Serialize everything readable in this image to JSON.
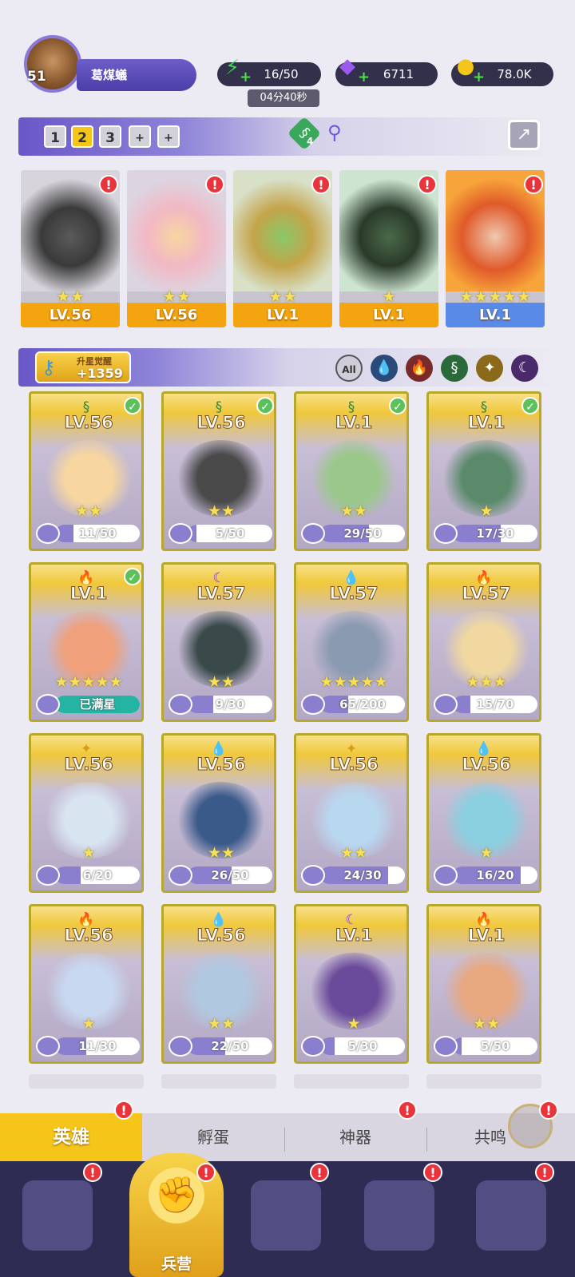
{
  "player": {
    "level": "51",
    "name": "葛煤蟻"
  },
  "resources": {
    "energy": "16/50",
    "timer": "04分40秒",
    "gems": "6711",
    "gold": "78.0K"
  },
  "team": {
    "slots": [
      "1",
      "2",
      "3",
      "+",
      "+"
    ],
    "active_slot": "2",
    "element_count": "4"
  },
  "heroes_team": [
    {
      "stars": "★★",
      "level": "LV.56",
      "element": "wind"
    },
    {
      "stars": "★★",
      "level": "LV.56",
      "element": "wind"
    },
    {
      "stars": "★★",
      "level": "LV.1",
      "element": "wind"
    },
    {
      "stars": "★",
      "level": "LV.1",
      "element": "wind"
    },
    {
      "stars": "★★★★★",
      "level": "LV.1",
      "element": "fire"
    }
  ],
  "awaken": {
    "label": "升星觉醒",
    "value": "+1359"
  },
  "filters": [
    "All",
    "water",
    "fire",
    "wind",
    "light",
    "dark"
  ],
  "cards": [
    {
      "level": "LV.56",
      "stars": "★★",
      "progress": "11/50",
      "fraction": 0.22,
      "element": "wind",
      "check": true
    },
    {
      "level": "LV.56",
      "stars": "★★",
      "progress": "5/50",
      "fraction": 0.1,
      "element": "wind",
      "check": true
    },
    {
      "level": "LV.1",
      "stars": "★★",
      "progress": "29/50",
      "fraction": 0.58,
      "element": "wind",
      "check": true
    },
    {
      "level": "LV.1",
      "stars": "★",
      "progress": "17/30",
      "fraction": 0.57,
      "element": "wind",
      "check": true
    },
    {
      "level": "LV.1",
      "stars": "★★★★★",
      "progress": "已满星",
      "fraction": 1.0,
      "element": "fire",
      "check": true
    },
    {
      "level": "LV.57",
      "stars": "★★",
      "progress": "9/30",
      "fraction": 0.3,
      "element": "dark",
      "check": false
    },
    {
      "level": "LV.57",
      "stars": "★★★★★",
      "progress": "65/200",
      "fraction": 0.33,
      "element": "water",
      "check": false
    },
    {
      "level": "LV.57",
      "stars": "★★★",
      "progress": "15/70",
      "fraction": 0.21,
      "element": "fire",
      "check": false
    },
    {
      "level": "LV.56",
      "stars": "★",
      "progress": "6/20",
      "fraction": 0.3,
      "element": "light",
      "check": false
    },
    {
      "level": "LV.56",
      "stars": "★★",
      "progress": "26/50",
      "fraction": 0.52,
      "element": "water",
      "check": false
    },
    {
      "level": "LV.56",
      "stars": "★★",
      "progress": "24/30",
      "fraction": 0.8,
      "element": "light",
      "check": false
    },
    {
      "level": "LV.56",
      "stars": "★",
      "progress": "16/20",
      "fraction": 0.8,
      "element": "water",
      "check": false
    },
    {
      "level": "LV.56",
      "stars": "★",
      "progress": "11/30",
      "fraction": 0.37,
      "element": "fire",
      "check": false
    },
    {
      "level": "LV.56",
      "stars": "★★",
      "progress": "22/50",
      "fraction": 0.44,
      "element": "water",
      "check": false
    },
    {
      "level": "LV.1",
      "stars": "★",
      "progress": "5/30",
      "fraction": 0.17,
      "element": "dark",
      "check": false
    },
    {
      "level": "LV.1",
      "stars": "★★",
      "progress": "5/50",
      "fraction": 0.1,
      "element": "fire",
      "check": false
    }
  ],
  "tabs": {
    "heroes": "英雄",
    "hatch": "孵蛋",
    "artifact": "神器",
    "resonance": "共鸣"
  },
  "nav": {
    "barracks": "兵营"
  },
  "badge": "!"
}
